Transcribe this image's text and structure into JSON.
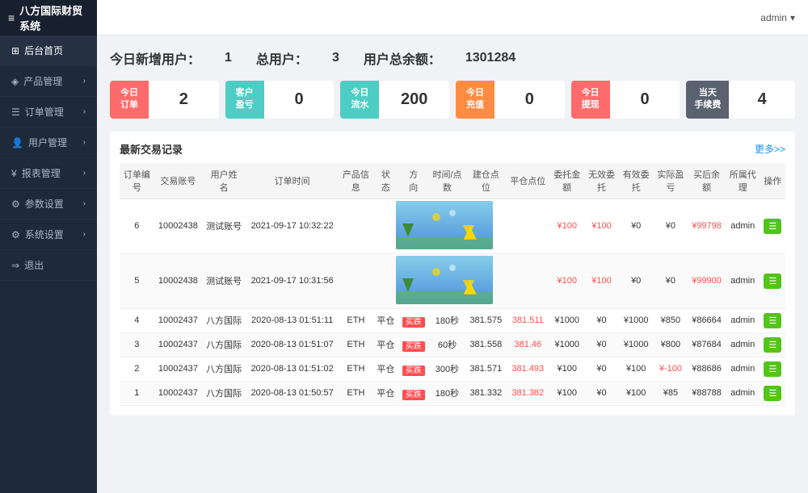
{
  "app": {
    "title": "八方国际财贸系统",
    "admin_label": "admin"
  },
  "sidebar": {
    "menu_icon": "≡",
    "items": [
      {
        "id": "dashboard",
        "icon": "⊞",
        "label": "后台首页",
        "active": true,
        "has_arrow": false
      },
      {
        "id": "products",
        "icon": "B",
        "label": "产品管理",
        "active": false,
        "has_arrow": true
      },
      {
        "id": "orders",
        "icon": "≡",
        "label": "订单管理",
        "active": false,
        "has_arrow": true
      },
      {
        "id": "users",
        "icon": "👤",
        "label": "用户管理",
        "active": false,
        "has_arrow": true
      },
      {
        "id": "reports",
        "icon": "¥",
        "label": "报表管理",
        "active": false,
        "has_arrow": true
      },
      {
        "id": "params",
        "icon": "⚙",
        "label": "参数设置",
        "active": false,
        "has_arrow": true
      },
      {
        "id": "system",
        "icon": "⚙",
        "label": "系统设置",
        "active": false,
        "has_arrow": true
      },
      {
        "id": "logout",
        "icon": "→",
        "label": "退出",
        "active": false,
        "has_arrow": false
      }
    ]
  },
  "stats": {
    "new_users_label": "今日新增用户：",
    "new_users_value": "1",
    "total_users_label": "总用户：",
    "total_users_value": "3",
    "balance_label": "用户总余额：",
    "balance_value": "1301284"
  },
  "cards": [
    {
      "id": "today-order",
      "label": "今日\n订单",
      "value": "2",
      "color": "red"
    },
    {
      "id": "client-profit",
      "label": "客户\n盈亏",
      "value": "0",
      "color": "teal"
    },
    {
      "id": "today-flow",
      "label": "今日\n流水",
      "value": "200",
      "color": "teal"
    },
    {
      "id": "today-recharge",
      "label": "今日\n充值",
      "value": "0",
      "color": "orange"
    },
    {
      "id": "today-withdraw",
      "label": "今日\n提现",
      "value": "0",
      "color": "red"
    },
    {
      "id": "daily-fee",
      "label": "当天\n手续费",
      "value": "4",
      "color": "dark"
    }
  ],
  "table": {
    "title": "最新交易记录",
    "more_label": "更多>>",
    "columns": [
      "订单编号",
      "交易账号",
      "用户姓名",
      "订单时间",
      "产品信息",
      "状态",
      "方向",
      "时间/点数",
      "建仓点位",
      "平仓点位",
      "委托金额",
      "无效委托",
      "有效委托",
      "实际盈亏",
      "买后余额",
      "所属代理",
      "操作"
    ],
    "rows": [
      {
        "id": "6",
        "trade_no": "10002438",
        "username": "测试账号",
        "time": "2021-09-17 10:32:22",
        "product": "",
        "status": "",
        "direction": "",
        "seconds": "",
        "open": "",
        "close": "",
        "entrust": "¥100",
        "invalid": "¥100",
        "valid": "¥0",
        "profit": "¥0",
        "balance": "¥99798",
        "agent": "admin",
        "has_image": true
      },
      {
        "id": "5",
        "trade_no": "10002438",
        "username": "测试账号",
        "time": "2021-09-17 10:31:56",
        "product": "",
        "status": "",
        "direction": "",
        "seconds": "",
        "open": "",
        "close": "",
        "entrust": "¥100",
        "invalid": "¥100",
        "valid": "¥0",
        "profit": "¥0",
        "balance": "¥99900",
        "agent": "admin",
        "has_image": true
      },
      {
        "id": "4",
        "trade_no": "10002437",
        "username": "八方国际",
        "time": "2020-08-13 01:51:11",
        "product": "ETH",
        "status": "平仓",
        "direction": "买跌",
        "seconds": "180秒",
        "open": "381.575",
        "close": "381.511",
        "entrust": "¥1000",
        "invalid": "¥0",
        "valid": "¥1000",
        "profit": "¥850",
        "balance": "¥86664",
        "agent": "admin",
        "has_image": false
      },
      {
        "id": "3",
        "trade_no": "10002437",
        "username": "八方国际",
        "time": "2020-08-13 01:51:07",
        "product": "ETH",
        "status": "平仓",
        "direction": "买跌",
        "seconds": "60秒",
        "open": "381.558",
        "close": "381.46",
        "entrust": "¥1000",
        "invalid": "¥0",
        "valid": "¥1000",
        "profit": "¥800",
        "balance": "¥87684",
        "agent": "admin",
        "has_image": false
      },
      {
        "id": "2",
        "trade_no": "10002437",
        "username": "八方国际",
        "time": "2020-08-13 01:51:02",
        "product": "ETH",
        "status": "平仓",
        "direction": "买跌",
        "seconds": "300秒",
        "open": "381.571",
        "close": "381.493",
        "entrust": "¥100",
        "invalid": "¥0",
        "valid": "¥100",
        "profit": "¥-100",
        "balance": "¥88686",
        "agent": "admin",
        "has_image": false
      },
      {
        "id": "1",
        "trade_no": "10002437",
        "username": "八方国际",
        "time": "2020-08-13 01:50:57",
        "product": "ETH",
        "status": "平仓",
        "direction": "买跌",
        "seconds": "180秒",
        "open": "381.332",
        "close": "381.382",
        "entrust": "¥100",
        "invalid": "¥0",
        "valid": "¥100",
        "profit": "¥85",
        "balance": "¥88788",
        "agent": "admin",
        "has_image": false
      }
    ]
  }
}
